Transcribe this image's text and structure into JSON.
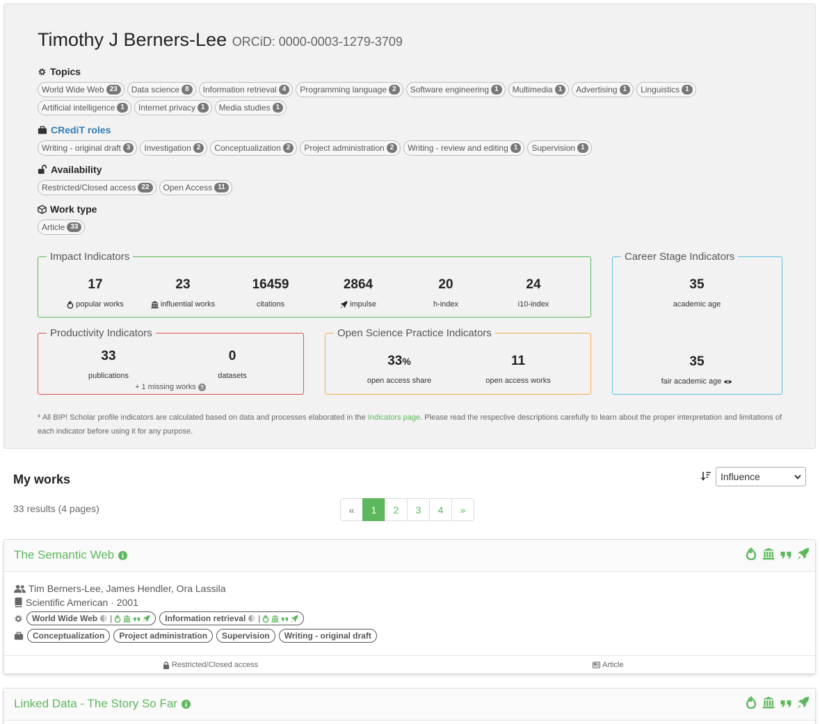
{
  "profile": {
    "name": "Timothy J Berners-Lee",
    "orcid": "ORCiD: 0000-0003-1279-3709"
  },
  "topics": {
    "title": "Topics",
    "items": [
      {
        "label": "World Wide Web",
        "count": "23"
      },
      {
        "label": "Data science",
        "count": "8"
      },
      {
        "label": "Information retrieval",
        "count": "4"
      },
      {
        "label": "Programming language",
        "count": "2"
      },
      {
        "label": "Software engineering",
        "count": "1"
      },
      {
        "label": "Multimedia",
        "count": "1"
      },
      {
        "label": "Advertising",
        "count": "1"
      },
      {
        "label": "Linguistics",
        "count": "1"
      },
      {
        "label": "Artificial intelligence",
        "count": "1"
      },
      {
        "label": "Internet privacy",
        "count": "1"
      },
      {
        "label": "Media studies",
        "count": "1"
      }
    ]
  },
  "credit": {
    "title": "CRediT roles",
    "items": [
      {
        "label": "Writing - original draft",
        "count": "3"
      },
      {
        "label": "Investigation",
        "count": "2"
      },
      {
        "label": "Conceptualization",
        "count": "2"
      },
      {
        "label": "Project administration",
        "count": "2"
      },
      {
        "label": "Writing - review and editing",
        "count": "1"
      },
      {
        "label": "Supervision",
        "count": "1"
      }
    ]
  },
  "availability": {
    "title": "Availability",
    "items": [
      {
        "label": "Restricted/Closed access",
        "count": "22"
      },
      {
        "label": "Open Access",
        "count": "11"
      }
    ]
  },
  "work_type": {
    "title": "Work type",
    "items": [
      {
        "label": "Article",
        "count": "33"
      }
    ]
  },
  "impact": {
    "legend": "Impact Indicators",
    "popular": {
      "value": "17",
      "label": "popular works"
    },
    "influential": {
      "value": "23",
      "label": "influential works"
    },
    "citations": {
      "value": "16459",
      "label": "citations"
    },
    "impulse": {
      "value": "2864",
      "label": "impulse"
    },
    "hindex": {
      "value": "20",
      "label": "h-index"
    },
    "i10": {
      "value": "24",
      "label": "i10-index"
    }
  },
  "career": {
    "legend": "Career Stage Indicators",
    "academic_age": {
      "value": "35",
      "label": "academic age"
    },
    "fair_age": {
      "value": "35",
      "label": "fair academic age"
    }
  },
  "productivity": {
    "legend": "Productivity Indicators",
    "publications": {
      "value": "33",
      "label": "publications"
    },
    "datasets": {
      "value": "0",
      "label": "datasets"
    },
    "missing": "+ 1 missing works"
  },
  "open_science": {
    "legend": "Open Science Practice Indicators",
    "share": {
      "value": "33",
      "unit": "%",
      "label": "open access share"
    },
    "works": {
      "value": "11",
      "label": "open access works"
    }
  },
  "note": {
    "prefix": "* All BIP! Scholar profile indicators are calculated based on data and processes elaborated in the ",
    "link": "Indicators page",
    "suffix": ". Please read the respective descriptions carefully to learn about the proper interpretation and limitations of each indicator before using it for any purpose."
  },
  "works": {
    "title": "My works",
    "results": "33 results (4 pages)",
    "sort_value": "Influence",
    "pages": [
      "«",
      "1",
      "2",
      "3",
      "4",
      "»"
    ],
    "active_page": "1"
  },
  "work_items": [
    {
      "title": "The Semantic Web",
      "authors": "Tim Berners-Lee, James Hendler, Ora Lassila",
      "venue": "Scientific American · 2001",
      "topics": [
        "World Wide Web",
        "Information retrieval"
      ],
      "roles": [
        "Conceptualization",
        "Project administration",
        "Supervision",
        "Writing - original draft"
      ],
      "access": "Restricted/Closed access",
      "type": "Article"
    },
    {
      "title": "Linked Data - The Story So Far"
    }
  ],
  "colors": {
    "accent": "#5cb85c",
    "impact_border": "#5cb85c",
    "career_border": "#5bc0de",
    "productivity_border": "#d9534f",
    "open_border": "#f0ad4e"
  }
}
